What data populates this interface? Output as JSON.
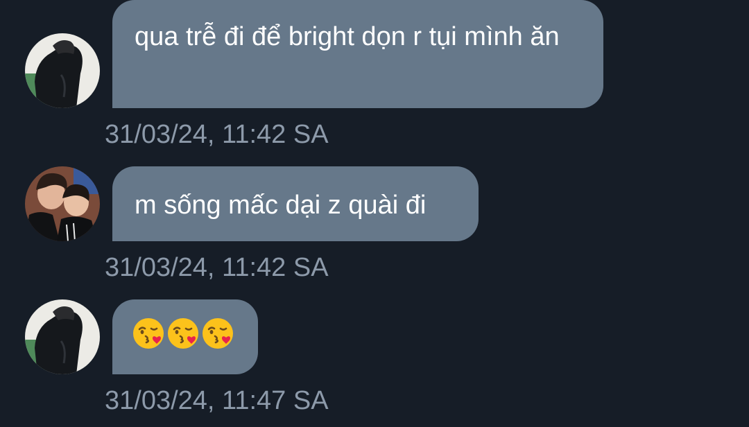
{
  "colors": {
    "background": "#161d27",
    "bubble": "#66788a",
    "message_text": "#ffffff",
    "timestamp_text": "#8d9aaa"
  },
  "messages": [
    {
      "avatar": "avatar-person-hoodie",
      "text": "qua trễ đi để bright dọn r tụi mình ăn",
      "timestamp": "31/03/24, 11:42 SA"
    },
    {
      "avatar": "avatar-two-people",
      "text": "m sống mấc dại z quài đi",
      "timestamp": "31/03/24, 11:42 SA"
    },
    {
      "avatar": "avatar-person-hoodie",
      "emojis": [
        "kissing-face-icon",
        "kissing-face-icon",
        "kissing-face-icon"
      ],
      "timestamp": "31/03/24, 11:47 SA"
    }
  ]
}
